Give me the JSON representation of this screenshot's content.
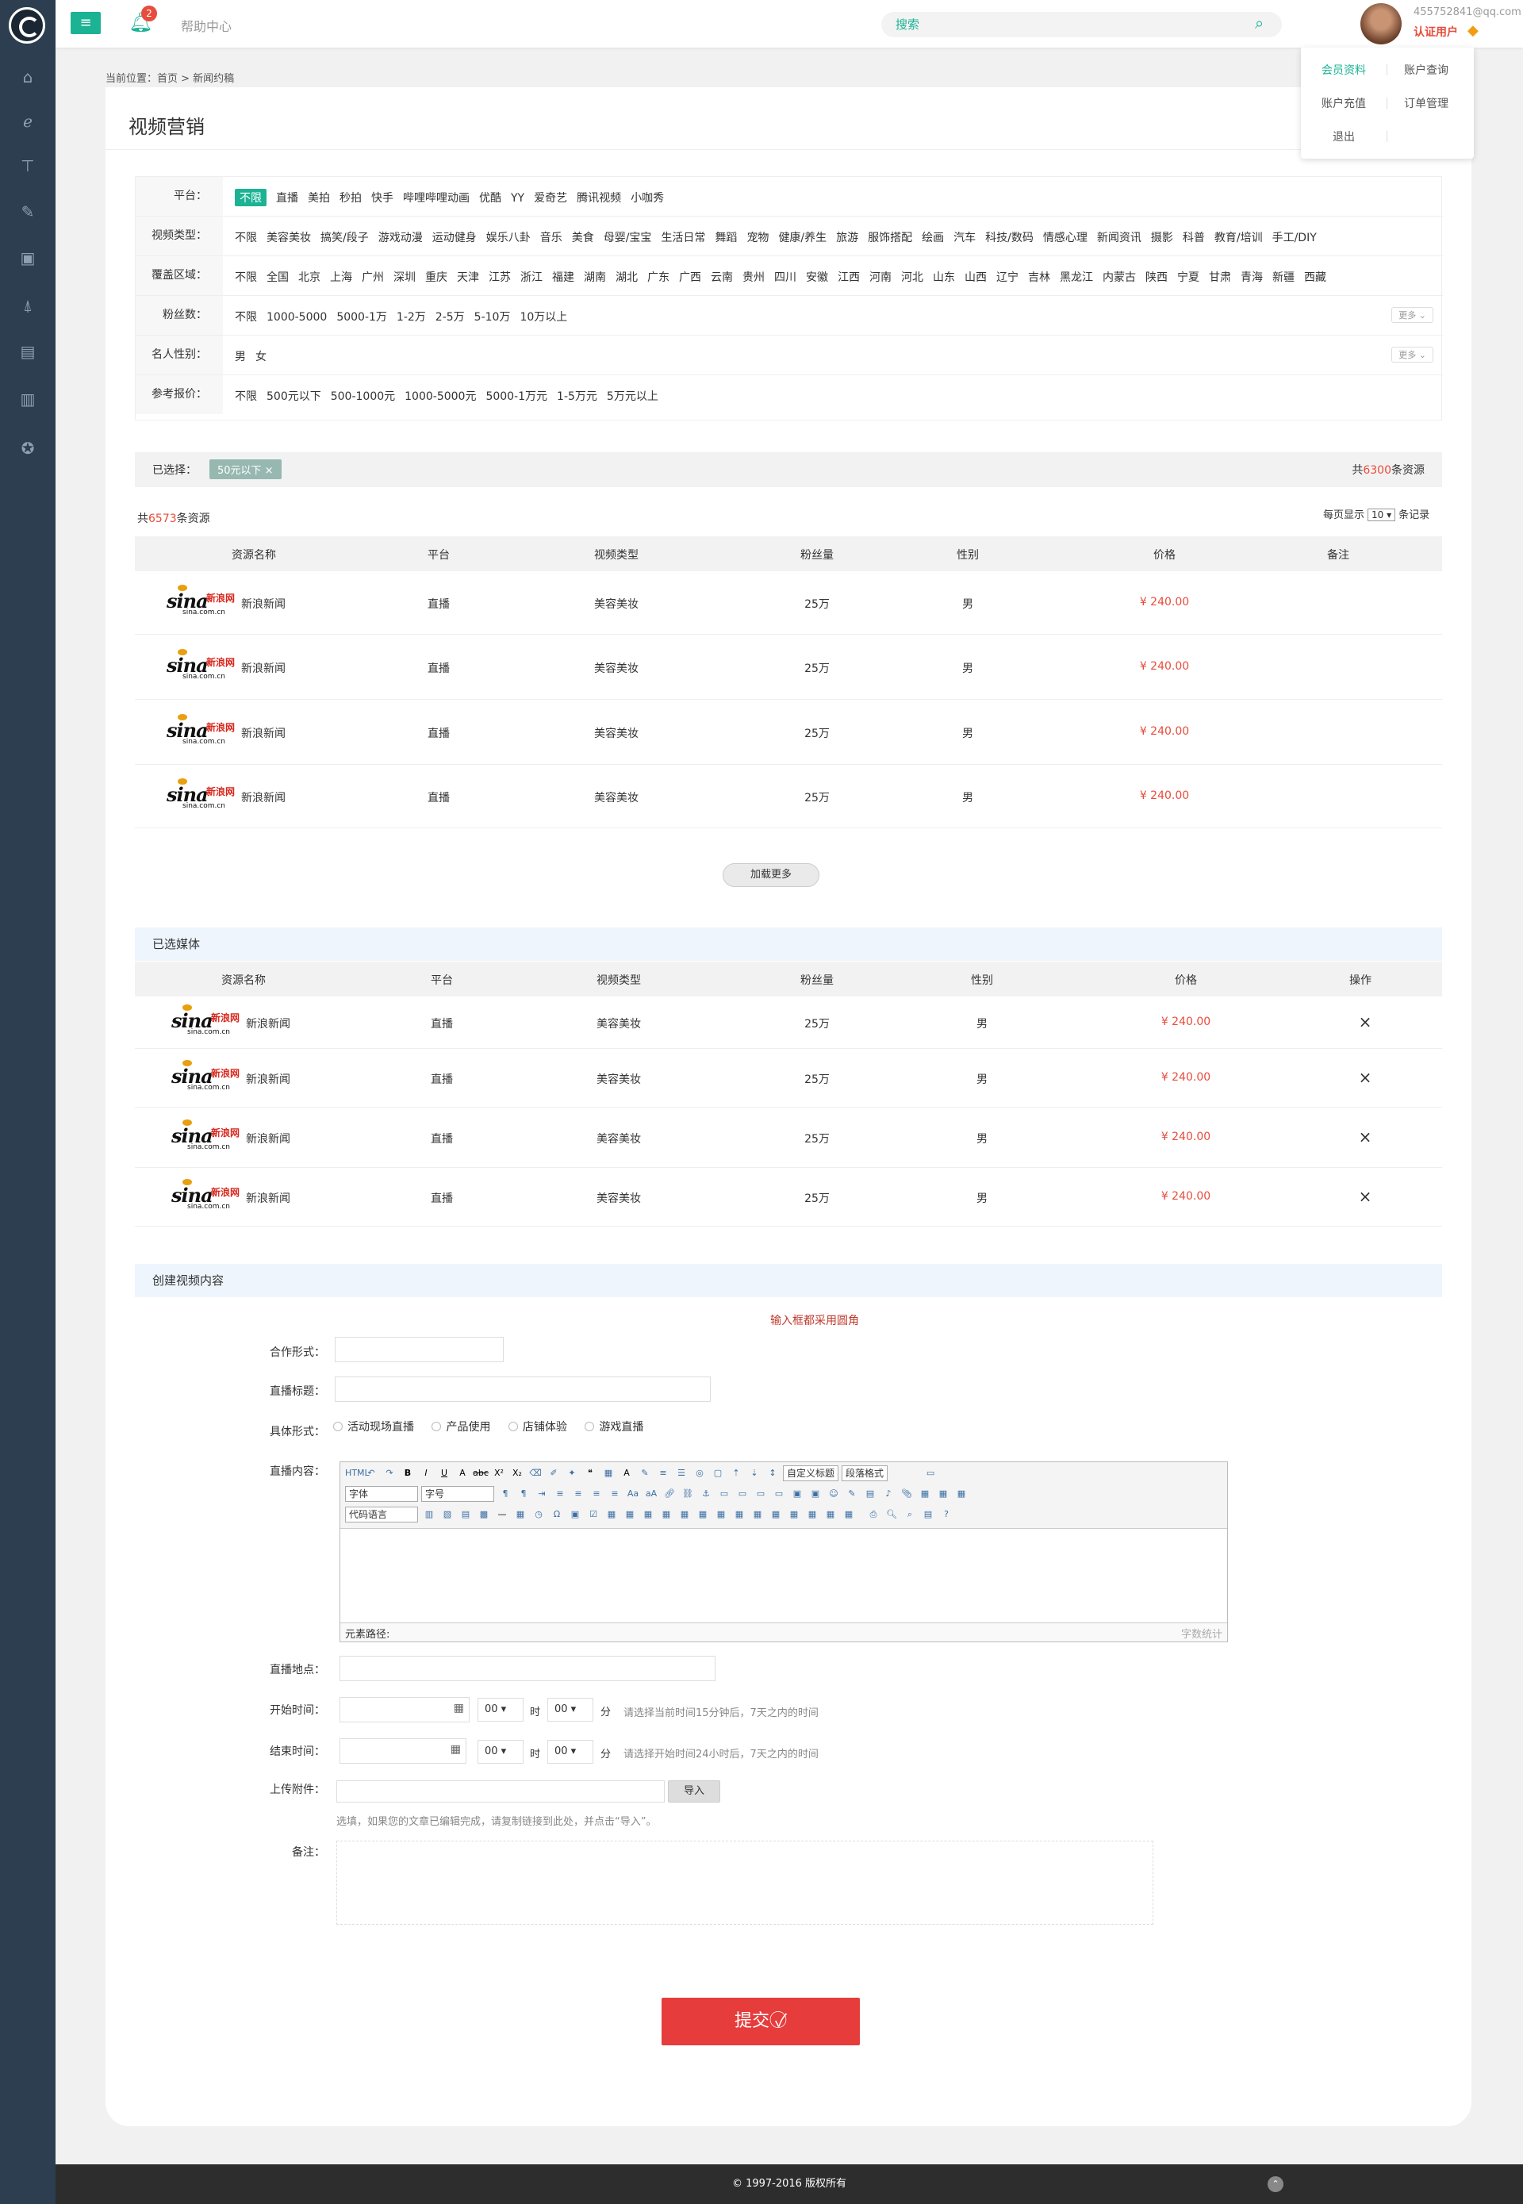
{
  "topbar": {
    "help": "帮助中心",
    "badge": "2",
    "search_placeholder": "搜索",
    "user_email": "455752841@qq.com",
    "user_status": "认证用户"
  },
  "user_menu": [
    "会员资料",
    "账户查询",
    "账户充值",
    "订单管理",
    "退出"
  ],
  "breadcrumb": "当前位置：首页 > 新闻约稿",
  "page_title": "视频营销",
  "filters": [
    {
      "label": "平台：",
      "options": [
        "不限",
        "直播",
        "美拍",
        "秒拍",
        "快手",
        "哔哩哔哩动画",
        "优酷",
        "YY",
        "爱奇艺",
        "腾讯视频",
        "小咖秀"
      ],
      "more": ""
    },
    {
      "label": "视频类型：",
      "options": [
        "不限",
        "美容美妆",
        "搞笑/段子",
        "游戏动漫",
        "运动健身",
        "娱乐八卦",
        "音乐",
        "美食",
        "母婴/宝宝",
        "生活日常",
        "舞蹈",
        "宠物",
        "健康/养生",
        "旅游",
        "服饰搭配",
        "绘画",
        "汽车",
        "科技/数码",
        "情感心理",
        "新闻资讯",
        "摄影",
        "科普",
        "教育/培训",
        "手工/DIY"
      ],
      "more": ""
    },
    {
      "label": "覆盖区域：",
      "options": [
        "不限",
        "全国",
        "北京",
        "上海",
        "广州",
        "深圳",
        "重庆",
        "天津",
        "江苏",
        "浙江",
        "福建",
        "湖南",
        "湖北",
        "广东",
        "广西",
        "云南",
        "贵州",
        "四川",
        "安徽",
        "江西",
        "河南",
        "河北",
        "山东",
        "山西",
        "辽宁",
        "吉林",
        "黑龙江",
        "内蒙古",
        "陕西",
        "宁夏",
        "甘肃",
        "青海",
        "新疆",
        "西藏"
      ],
      "more": ""
    },
    {
      "label": "粉丝数：",
      "options": [
        "不限",
        "1000-5000",
        "5000-1万",
        "1-2万",
        "2-5万",
        "5-10万",
        "10万以上"
      ],
      "more": "更多"
    },
    {
      "label": "名人性别：",
      "options": [
        "男",
        "女"
      ],
      "more": "更多"
    },
    {
      "label": "参考报价：",
      "options": [
        "不限",
        "500元以下",
        "500-1000元",
        "1000-5000元",
        "5000-1万元",
        "1-5万元",
        "5万元以上"
      ],
      "more": ""
    }
  ],
  "selected": {
    "label": "已选择：",
    "tag": "50元以下 ×",
    "total_prefix": "共",
    "total_count": "6300",
    "total_suffix": "条资源"
  },
  "resources": {
    "count_prefix": "共",
    "count": "6573",
    "count_suffix": "条资源",
    "per_page_prefix": "每页显示",
    "per_page": "10 ▾",
    "per_page_suffix": "条记录",
    "headers": [
      "资源名称",
      "平台",
      "视频类型",
      "粉丝量",
      "性别",
      "价格",
      "备注"
    ],
    "rows": [
      {
        "name": "新浪新闻",
        "platform": "直播",
        "type": "美容美妆",
        "fans": "25万",
        "gender": "男",
        "price": "¥ 240.00",
        "note": ""
      },
      {
        "name": "新浪新闻",
        "platform": "直播",
        "type": "美容美妆",
        "fans": "25万",
        "gender": "男",
        "price": "¥ 240.00",
        "note": ""
      },
      {
        "name": "新浪新闻",
        "platform": "直播",
        "type": "美容美妆",
        "fans": "25万",
        "gender": "男",
        "price": "¥ 240.00",
        "note": ""
      },
      {
        "name": "新浪新闻",
        "platform": "直播",
        "type": "美容美妆",
        "fans": "25万",
        "gender": "男",
        "price": "¥ 240.00",
        "note": ""
      }
    ],
    "load_more": "加载更多"
  },
  "logo": {
    "word": "sina",
    "cn": "新浪网",
    "url": "sina.com.cn"
  },
  "chosen": {
    "title": "已选媒体",
    "headers": [
      "资源名称",
      "平台",
      "视频类型",
      "粉丝量",
      "性别",
      "价格",
      "操作"
    ],
    "rows": [
      {
        "name": "新浪新闻",
        "platform": "直播",
        "type": "美容美妆",
        "fans": "25万",
        "gender": "男",
        "price": "¥ 240.00"
      },
      {
        "name": "新浪新闻",
        "platform": "直播",
        "type": "美容美妆",
        "fans": "25万",
        "gender": "男",
        "price": "¥ 240.00"
      },
      {
        "name": "新浪新闻",
        "platform": "直播",
        "type": "美容美妆",
        "fans": "25万",
        "gender": "男",
        "price": "¥ 240.00"
      },
      {
        "name": "新浪新闻",
        "platform": "直播",
        "type": "美容美妆",
        "fans": "25万",
        "gender": "男",
        "price": "¥ 240.00"
      }
    ]
  },
  "form": {
    "title": "创建视频内容",
    "hint": "输入框都采用圆角",
    "coop_label": "合作形式：",
    "live_title_label": "直播标题：",
    "form_type_label": "具体形式：",
    "form_types": [
      "活动现场直播",
      "产品使用",
      "店铺体验",
      "游戏直播"
    ],
    "content_label": "直播内容：",
    "editor": {
      "custom_title": "自定义标题",
      "paragraph": "段落格式",
      "font": "字体",
      "font_size": "字号",
      "code_lang": "代码语言",
      "path": "元素路径:",
      "count": "字数统计"
    },
    "location_label": "直播地点：",
    "start_label": "开始时间：",
    "end_label": "结束时间：",
    "hour_value": "00",
    "minute_value": "00",
    "hour_unit": "时",
    "minute_unit": "分",
    "start_hint": "请选择当前时间15分钟后，7天之内的时间",
    "end_hint": "请选择开始时间24小时后，7天之内的时间",
    "upload_label": "上传附件：",
    "import": "导入",
    "upload_hint": "选填，如果您的文章已编辑完成，请复制链接到此处，并点击“导入”。",
    "note_label": "备注：",
    "submit": "提交"
  },
  "footer": "© 1997-2016 版权所有",
  "colors": {
    "accent": "#1bb394",
    "price": "#e74c3c",
    "submit": "#e63c3c",
    "sidebar": "#2c3e50"
  }
}
